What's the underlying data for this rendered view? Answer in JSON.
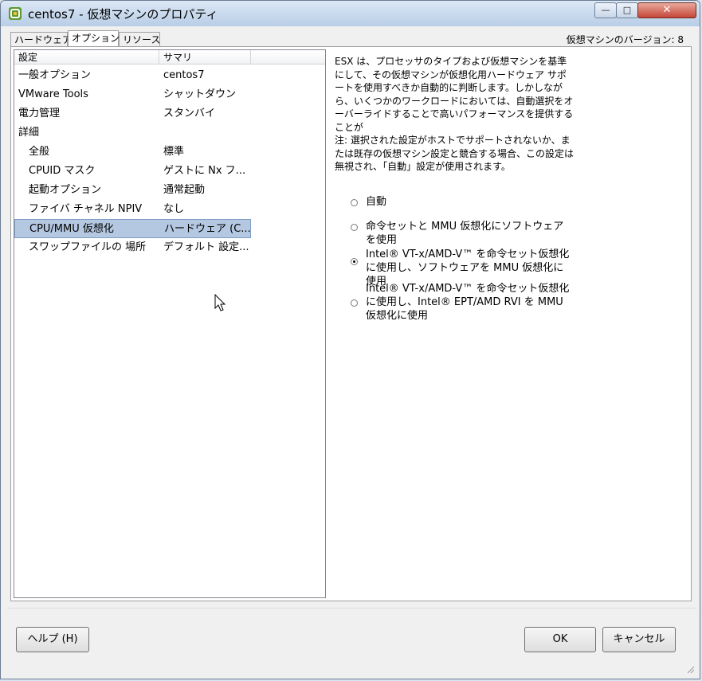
{
  "window": {
    "title": "centos7 - 仮想マシンのプロパティ",
    "minimize": "—",
    "maximize": "□",
    "close": "✕"
  },
  "tabs": [
    "ハードウェア",
    "オプション",
    "リソース"
  ],
  "version_label": "仮想マシンのバージョン: 8",
  "list": {
    "headers": [
      "設定",
      "サマリ"
    ],
    "rows": [
      {
        "name": "一般オプション",
        "value": "centos7"
      },
      {
        "name": "VMware Tools",
        "value": "シャットダウン"
      },
      {
        "name": "電力管理",
        "value": "スタンバイ"
      },
      {
        "name": "詳細",
        "value": ""
      },
      {
        "name": "全般",
        "value": "標準"
      },
      {
        "name": "CPUID マスク",
        "value": "ゲストに Nx フ..."
      },
      {
        "name": "起動オプション",
        "value": "通常起動"
      },
      {
        "name": "ファイバ チャネル NPIV",
        "value": "なし"
      },
      {
        "name": "CPU/MMU 仮想化",
        "value": "ハードウェア (C..."
      },
      {
        "name": "スワップファイルの 場所",
        "value": "デフォルト 設定..."
      }
    ]
  },
  "details": {
    "description": "ESX は、プロセッサのタイプおよび仮想マシンを基準にして、その仮想マシンが仮想化用ハードウェア サポートを使用すべきか自動的に判断します。しかしながら、いくつかのワークロードにおいては、自動選択をオーバーライドすることで高いパフォーマンスを提供することが",
    "note": "注: 選択された設定がホストでサポートされないか、または既存の仮想マシン設定と競合する場合、この設定は無視され、「自動」設定が使用されます。",
    "options": [
      "自動",
      "命令セットと MMU 仮想化にソフトウェアを使用",
      "Intel® VT-x/AMD-V™ を命令セット仮想化に使用し、ソフトウェアを MMU 仮想化に使用",
      "Intel® VT-x/AMD-V™ を命令セット仮想化に使用し、Intel® EPT/AMD RVI を MMU 仮想化に使用"
    ],
    "selected_option_index": 2
  },
  "buttons": {
    "help": "ヘルプ (H)",
    "ok": "OK",
    "cancel": "キャンセル"
  },
  "colors": {
    "selection": "#b5c8e2",
    "titlebar": "#b8cde6"
  }
}
